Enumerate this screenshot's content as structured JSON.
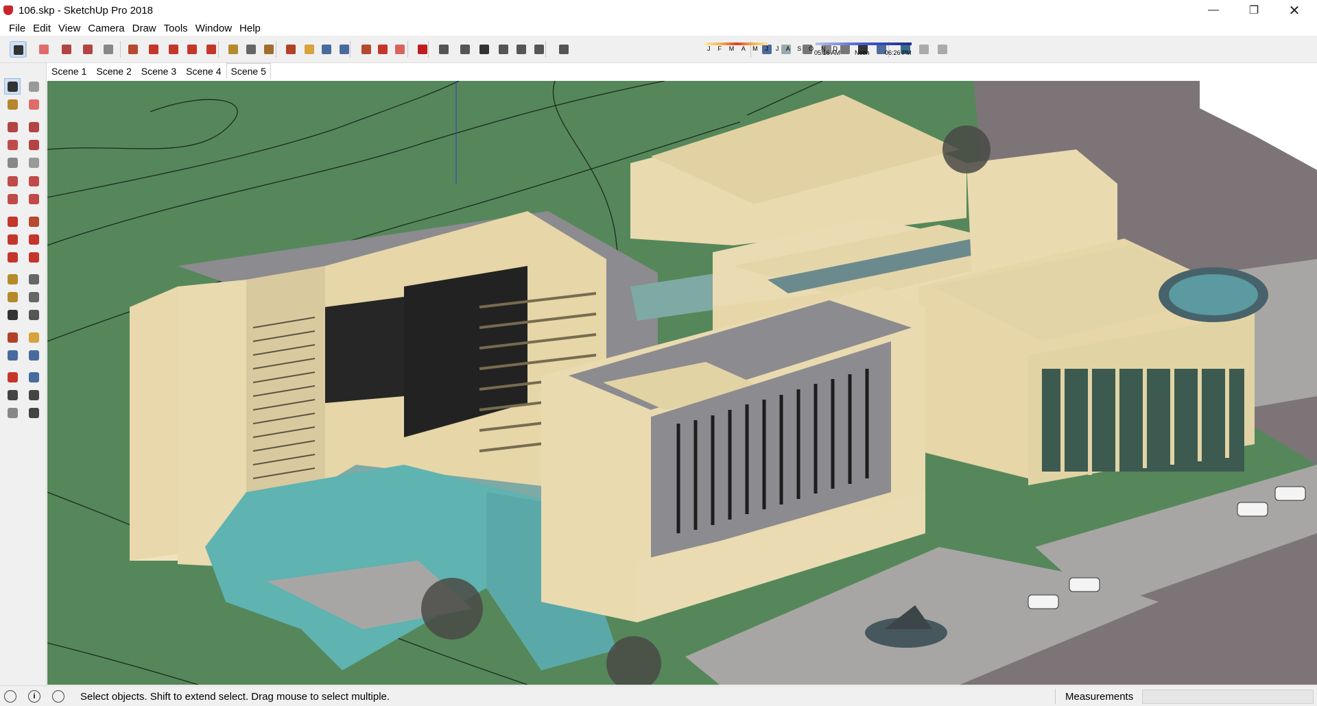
{
  "window": {
    "title": "106.skp - SketchUp Pro 2018",
    "minimize_glyph": "—",
    "maximize_glyph": "❐",
    "close_glyph": "✕"
  },
  "menu": [
    "File",
    "Edit",
    "View",
    "Camera",
    "Draw",
    "Tools",
    "Window",
    "Help"
  ],
  "shadows": {
    "months": "J F M A M J J A S O N D",
    "time_start": "05:16 AM",
    "time_noon": "Noon",
    "time_end": "06:26 PM"
  },
  "scenes": [
    "Scene 1",
    "Scene 2",
    "Scene 3",
    "Scene 4",
    "Scene 5"
  ],
  "active_scene": "Scene 5",
  "toolbar_icons": [
    "select-icon",
    "eraser-icon",
    "pencil-icon",
    "arc-icon",
    "rectangle-icon",
    "push-pull-icon",
    "follow-me-icon",
    "move-icon",
    "rotate-icon",
    "scale-icon",
    "tape-measure-icon",
    "text-icon",
    "paint-bucket-icon",
    "orbit-icon",
    "pan-icon",
    "zoom-icon",
    "zoom-extents-icon",
    "warehouse-icon",
    "extension-warehouse-icon",
    "layout-icon",
    "ruby-icon",
    "iso-view-icon",
    "top-view-icon",
    "front-view-icon",
    "right-view-icon",
    "back-view-icon",
    "left-view-icon",
    "shadows-toggle-icon",
    "xray-icon",
    "back-edges-icon",
    "wireframe-icon",
    "hidden-line-icon",
    "shaded-icon",
    "shaded-textures-icon",
    "monochrome-icon",
    "section-plane-icon",
    "section-display-icon",
    "section-cut-icon"
  ],
  "palette_icons": [
    "select-icon",
    "make-component-icon",
    "paint-bucket-icon",
    "eraser-icon",
    "line-icon",
    "freehand-icon",
    "rectangle-icon",
    "rotated-rectangle-icon",
    "circle-icon",
    "polygon-icon",
    "arc-icon",
    "2pt-arc-icon",
    "3pt-arc-icon",
    "pie-icon",
    "move-icon",
    "push-pull-icon",
    "rotate-icon",
    "follow-me-icon",
    "scale-icon",
    "offset-icon",
    "tape-measure-icon",
    "dimension-icon",
    "protractor-icon",
    "text-icon",
    "axes-icon",
    "3d-text-icon",
    "orbit-icon",
    "pan-icon",
    "zoom-icon",
    "zoom-window-icon",
    "zoom-extents-icon",
    "previous-view-icon",
    "position-camera-icon",
    "look-around-icon",
    "walk-icon",
    "section-plane-icon"
  ],
  "status": {
    "hint": "Select objects. Shift to extend select. Drag mouse to select multiple.",
    "measurements_label": "Measurements",
    "measurements_value": ""
  },
  "colors": {
    "ground": "#55875a",
    "building": "#ebdcb0",
    "roof_dark": "#8c8b8f",
    "road": "#7d7478",
    "water": "#5fb3b0",
    "paving": "#a8a6a4"
  }
}
